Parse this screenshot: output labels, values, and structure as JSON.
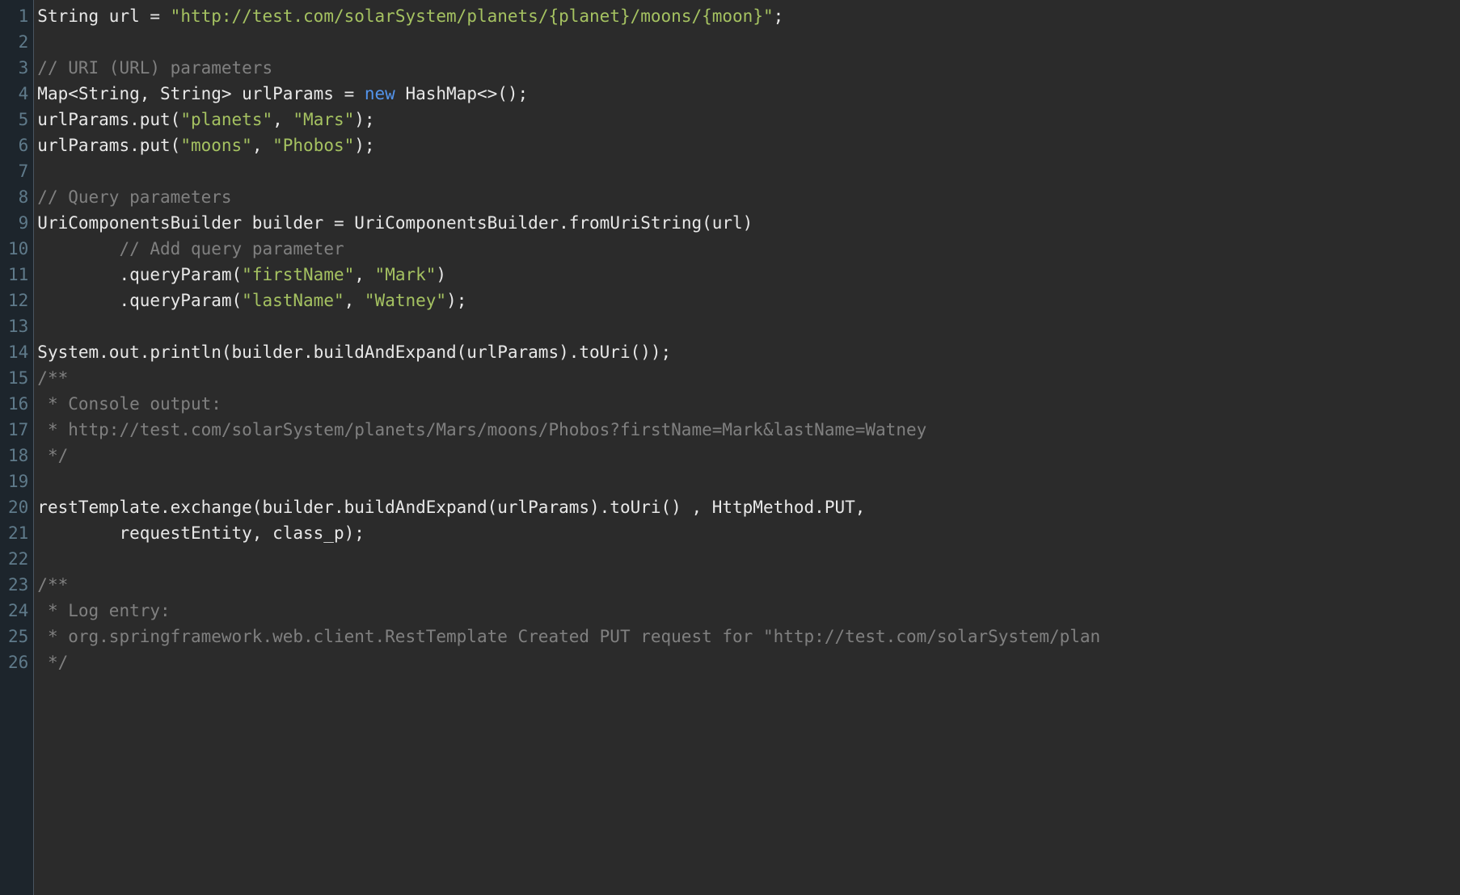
{
  "code": {
    "lines": [
      {
        "n": "1",
        "tokens": [
          {
            "c": "tok-type",
            "t": "String url "
          },
          {
            "c": "tok-op",
            "t": "= "
          },
          {
            "c": "tok-string",
            "t": "\"http://test.com/solarSystem/planets/{planet}/moons/{moon}\""
          },
          {
            "c": "tok-punc",
            "t": ";"
          }
        ]
      },
      {
        "n": "2",
        "tokens": []
      },
      {
        "n": "3",
        "tokens": [
          {
            "c": "tok-comment",
            "t": "// URI (URL) parameters"
          }
        ]
      },
      {
        "n": "4",
        "tokens": [
          {
            "c": "tok-type",
            "t": "Map<String, String> urlParams "
          },
          {
            "c": "tok-op",
            "t": "= "
          },
          {
            "c": "tok-keyword",
            "t": "new "
          },
          {
            "c": "tok-type",
            "t": "HashMap<>();"
          }
        ]
      },
      {
        "n": "5",
        "tokens": [
          {
            "c": "tok-ident",
            "t": "urlParams.put("
          },
          {
            "c": "tok-string",
            "t": "\"planets\""
          },
          {
            "c": "tok-ident",
            "t": ", "
          },
          {
            "c": "tok-string",
            "t": "\"Mars\""
          },
          {
            "c": "tok-ident",
            "t": ");"
          }
        ]
      },
      {
        "n": "6",
        "tokens": [
          {
            "c": "tok-ident",
            "t": "urlParams.put("
          },
          {
            "c": "tok-string",
            "t": "\"moons\""
          },
          {
            "c": "tok-ident",
            "t": ", "
          },
          {
            "c": "tok-string",
            "t": "\"Phobos\""
          },
          {
            "c": "tok-ident",
            "t": ");"
          }
        ]
      },
      {
        "n": "7",
        "tokens": []
      },
      {
        "n": "8",
        "tokens": [
          {
            "c": "tok-comment",
            "t": "// Query parameters"
          }
        ]
      },
      {
        "n": "9",
        "tokens": [
          {
            "c": "tok-type",
            "t": "UriComponentsBuilder builder "
          },
          {
            "c": "tok-op",
            "t": "= "
          },
          {
            "c": "tok-ident",
            "t": "UriComponentsBuilder.fromUriString(url)"
          }
        ]
      },
      {
        "n": "10",
        "tokens": [
          {
            "c": "tok-ident",
            "t": "        "
          },
          {
            "c": "tok-comment",
            "t": "// Add query parameter"
          }
        ]
      },
      {
        "n": "11",
        "tokens": [
          {
            "c": "tok-ident",
            "t": "        .queryParam("
          },
          {
            "c": "tok-string",
            "t": "\"firstName\""
          },
          {
            "c": "tok-ident",
            "t": ", "
          },
          {
            "c": "tok-string",
            "t": "\"Mark\""
          },
          {
            "c": "tok-ident",
            "t": ")"
          }
        ]
      },
      {
        "n": "12",
        "tokens": [
          {
            "c": "tok-ident",
            "t": "        .queryParam("
          },
          {
            "c": "tok-string",
            "t": "\"lastName\""
          },
          {
            "c": "tok-ident",
            "t": ", "
          },
          {
            "c": "tok-string",
            "t": "\"Watney\""
          },
          {
            "c": "tok-ident",
            "t": ");"
          }
        ]
      },
      {
        "n": "13",
        "tokens": []
      },
      {
        "n": "14",
        "tokens": [
          {
            "c": "tok-ident",
            "t": "System.out.println(builder.buildAndExpand(urlParams).toUri());"
          }
        ]
      },
      {
        "n": "15",
        "tokens": [
          {
            "c": "tok-comment",
            "t": "/**"
          }
        ]
      },
      {
        "n": "16",
        "tokens": [
          {
            "c": "tok-comment",
            "t": " * Console output:"
          }
        ]
      },
      {
        "n": "17",
        "tokens": [
          {
            "c": "tok-comment",
            "t": " * http://test.com/solarSystem/planets/Mars/moons/Phobos?firstName=Mark&lastName=Watney"
          }
        ]
      },
      {
        "n": "18",
        "tokens": [
          {
            "c": "tok-comment",
            "t": " */"
          }
        ]
      },
      {
        "n": "19",
        "tokens": []
      },
      {
        "n": "20",
        "tokens": [
          {
            "c": "tok-ident",
            "t": "restTemplate.exchange(builder.buildAndExpand(urlParams).toUri() , HttpMethod.PUT,"
          }
        ]
      },
      {
        "n": "21",
        "tokens": [
          {
            "c": "tok-ident",
            "t": "        requestEntity, class_p);"
          }
        ]
      },
      {
        "n": "22",
        "tokens": []
      },
      {
        "n": "23",
        "tokens": [
          {
            "c": "tok-comment",
            "t": "/**"
          }
        ]
      },
      {
        "n": "24",
        "tokens": [
          {
            "c": "tok-comment",
            "t": " * Log entry:"
          }
        ]
      },
      {
        "n": "25",
        "tokens": [
          {
            "c": "tok-comment",
            "t": " * org.springframework.web.client.RestTemplate Created PUT request for \"http://test.com/solarSystem/plan"
          }
        ]
      },
      {
        "n": "26",
        "tokens": [
          {
            "c": "tok-comment",
            "t": " */"
          }
        ]
      }
    ]
  }
}
